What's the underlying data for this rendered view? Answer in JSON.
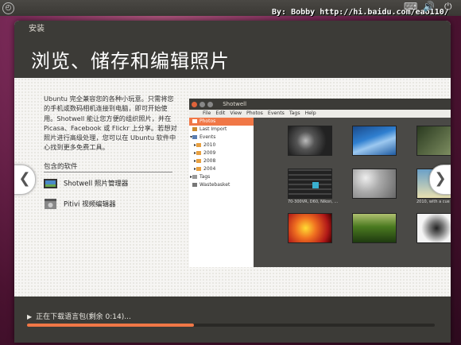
{
  "panel": {
    "watermark": "By: Bobby http://hi.baidu.com/eao110/"
  },
  "window": {
    "title": "安装",
    "heading": "浏览、储存和编辑照片"
  },
  "slide": {
    "description": "Ubuntu 完全兼容您的各种小玩意。只需将您的手机或数码相机连接到电脑，即可开始使用。Shotwell 能让您方便的组织照片，并在 Picasa、Facebook 或 Flickr 上分享。若想对照片进行高级处理，您可以在 Ubuntu 软件中心找到更多免费工具。",
    "included_title": "包含的软件",
    "apps": [
      {
        "label": "Shotwell 照片管理器"
      },
      {
        "label": "Pitivi 视频编辑器"
      }
    ],
    "prev_arrow": "❮",
    "next_arrow": "❯"
  },
  "shotwell": {
    "title": "Shotwell",
    "menu": [
      "File",
      "Edit",
      "View",
      "Photos",
      "Events",
      "Tags",
      "Help"
    ],
    "sidebar": [
      "Photos",
      "Last Import",
      "Events",
      "2010",
      "2009",
      "2008",
      "2004",
      "Tags",
      "Wastebasket"
    ],
    "captions": [
      "70-300VR, D60, Nikon, ...",
      "2010, with a cue"
    ]
  },
  "status": {
    "text": "正在下载语言包(剩余 0:14)...",
    "progress": 0.41
  },
  "colors": {
    "accent": "#f07746",
    "dark": "#3c3b37"
  }
}
